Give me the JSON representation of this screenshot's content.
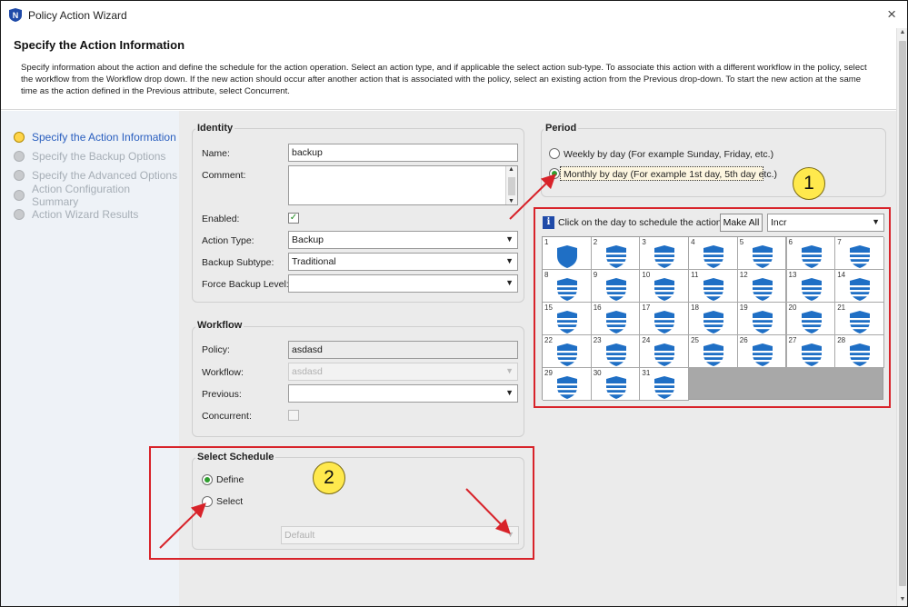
{
  "window": {
    "title": "Policy Action Wizard",
    "close_glyph": "×",
    "app_icon": "nsr-shield-icon"
  },
  "header": {
    "title": "Specify the Action Information",
    "description": "Specify information about the action and define the schedule for the action operation. Select an action type, and if applicable the select action sub-type. To associate this action with a different workflow in the policy, select the workflow from the Workflow drop down. If the new action should occur after another action that is associated with the policy, select an existing action from the Previous drop-down. To start the new action at the same time as the action defined in the Previous attribute, select Concurrent."
  },
  "sidebar": {
    "items": [
      {
        "label": "Specify the Action Information",
        "active": true
      },
      {
        "label": "Specify the Backup Options",
        "active": false
      },
      {
        "label": "Specify the Advanced Options",
        "active": false
      },
      {
        "label": "Action Configuration Summary",
        "active": false
      },
      {
        "label": "Action Wizard Results",
        "active": false
      }
    ]
  },
  "identity": {
    "title": "Identity",
    "name_label": "Name:",
    "name_value": "backup",
    "comment_label": "Comment:",
    "enabled_label": "Enabled:",
    "enabled_checked": true,
    "action_type_label": "Action Type:",
    "action_type_value": "Backup",
    "backup_subtype_label": "Backup Subtype:",
    "backup_subtype_value": "Traditional",
    "force_level_label": "Force Backup Level:",
    "force_level_value": ""
  },
  "workflow": {
    "title": "Workflow",
    "policy_label": "Policy:",
    "policy_value": "asdasd",
    "workflow_label": "Workflow:",
    "workflow_value": "asdasd",
    "previous_label": "Previous:",
    "previous_value": "",
    "concurrent_label": "Concurrent:",
    "concurrent_checked": false
  },
  "schedule": {
    "title": "Select Schedule",
    "define_label": "Define",
    "select_label": "Select",
    "selected": "Define",
    "schedule_value": "Default"
  },
  "period": {
    "title": "Period",
    "weekly_label": "Weekly by day  (For example Sunday, Friday, etc.)",
    "monthly_label": "Monthly by day (For example 1st day, 5th day etc.)",
    "selected": "Monthly"
  },
  "calendar": {
    "hint": "Click on the day to schedule the action",
    "make_all_label": "Make All",
    "level_value": "Incr",
    "days": [
      {
        "day": "1",
        "level": "full"
      },
      {
        "day": "2",
        "level": "incr"
      },
      {
        "day": "3",
        "level": "incr"
      },
      {
        "day": "4",
        "level": "incr"
      },
      {
        "day": "5",
        "level": "incr"
      },
      {
        "day": "6",
        "level": "incr"
      },
      {
        "day": "7",
        "level": "incr"
      },
      {
        "day": "8",
        "level": "incr"
      },
      {
        "day": "9",
        "level": "incr"
      },
      {
        "day": "10",
        "level": "incr"
      },
      {
        "day": "11",
        "level": "incr"
      },
      {
        "day": "12",
        "level": "incr"
      },
      {
        "day": "13",
        "level": "incr"
      },
      {
        "day": "14",
        "level": "incr"
      },
      {
        "day": "15",
        "level": "incr"
      },
      {
        "day": "16",
        "level": "incr"
      },
      {
        "day": "17",
        "level": "incr"
      },
      {
        "day": "18",
        "level": "incr"
      },
      {
        "day": "19",
        "level": "incr"
      },
      {
        "day": "20",
        "level": "incr"
      },
      {
        "day": "21",
        "level": "incr"
      },
      {
        "day": "22",
        "level": "incr"
      },
      {
        "day": "23",
        "level": "incr"
      },
      {
        "day": "24",
        "level": "incr"
      },
      {
        "day": "25",
        "level": "incr"
      },
      {
        "day": "26",
        "level": "incr"
      },
      {
        "day": "27",
        "level": "incr"
      },
      {
        "day": "28",
        "level": "incr"
      },
      {
        "day": "29",
        "level": "incr"
      },
      {
        "day": "30",
        "level": "incr"
      },
      {
        "day": "31",
        "level": "incr"
      }
    ]
  },
  "annotations": {
    "badge_1": "1",
    "badge_2": "2",
    "highlight_color": "#d8232a",
    "badge_color": "#ffe94d"
  },
  "colors": {
    "shield_blue": "#1f6fc5",
    "active_step": "#2a5fbf",
    "panel_bg": "#ebebeb",
    "sidebar_bg": "#eef2f7"
  }
}
